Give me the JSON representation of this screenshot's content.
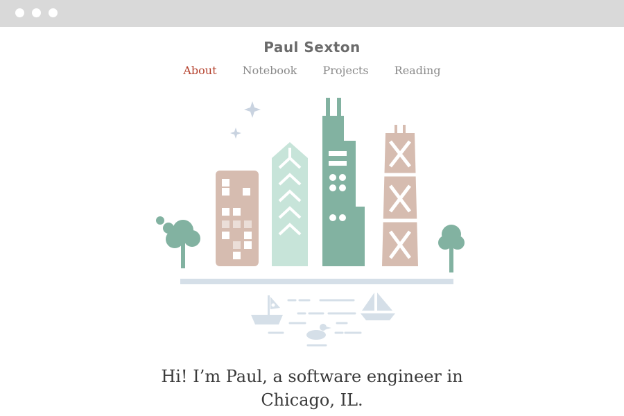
{
  "site": {
    "title": "Paul Sexton"
  },
  "nav": {
    "items": [
      "About",
      "Notebook",
      "Projects",
      "Reading"
    ],
    "active": "About"
  },
  "hero": {
    "line1": "Hi! I’m Paul, a software engineer in",
    "line2": "Chicago, IL."
  },
  "colors": {
    "accent": "#b5432f",
    "pink_building": "#d6bcb0",
    "mint": "#c7e4d9",
    "teal": "#82b2a1",
    "water": "#d5dfe8"
  }
}
